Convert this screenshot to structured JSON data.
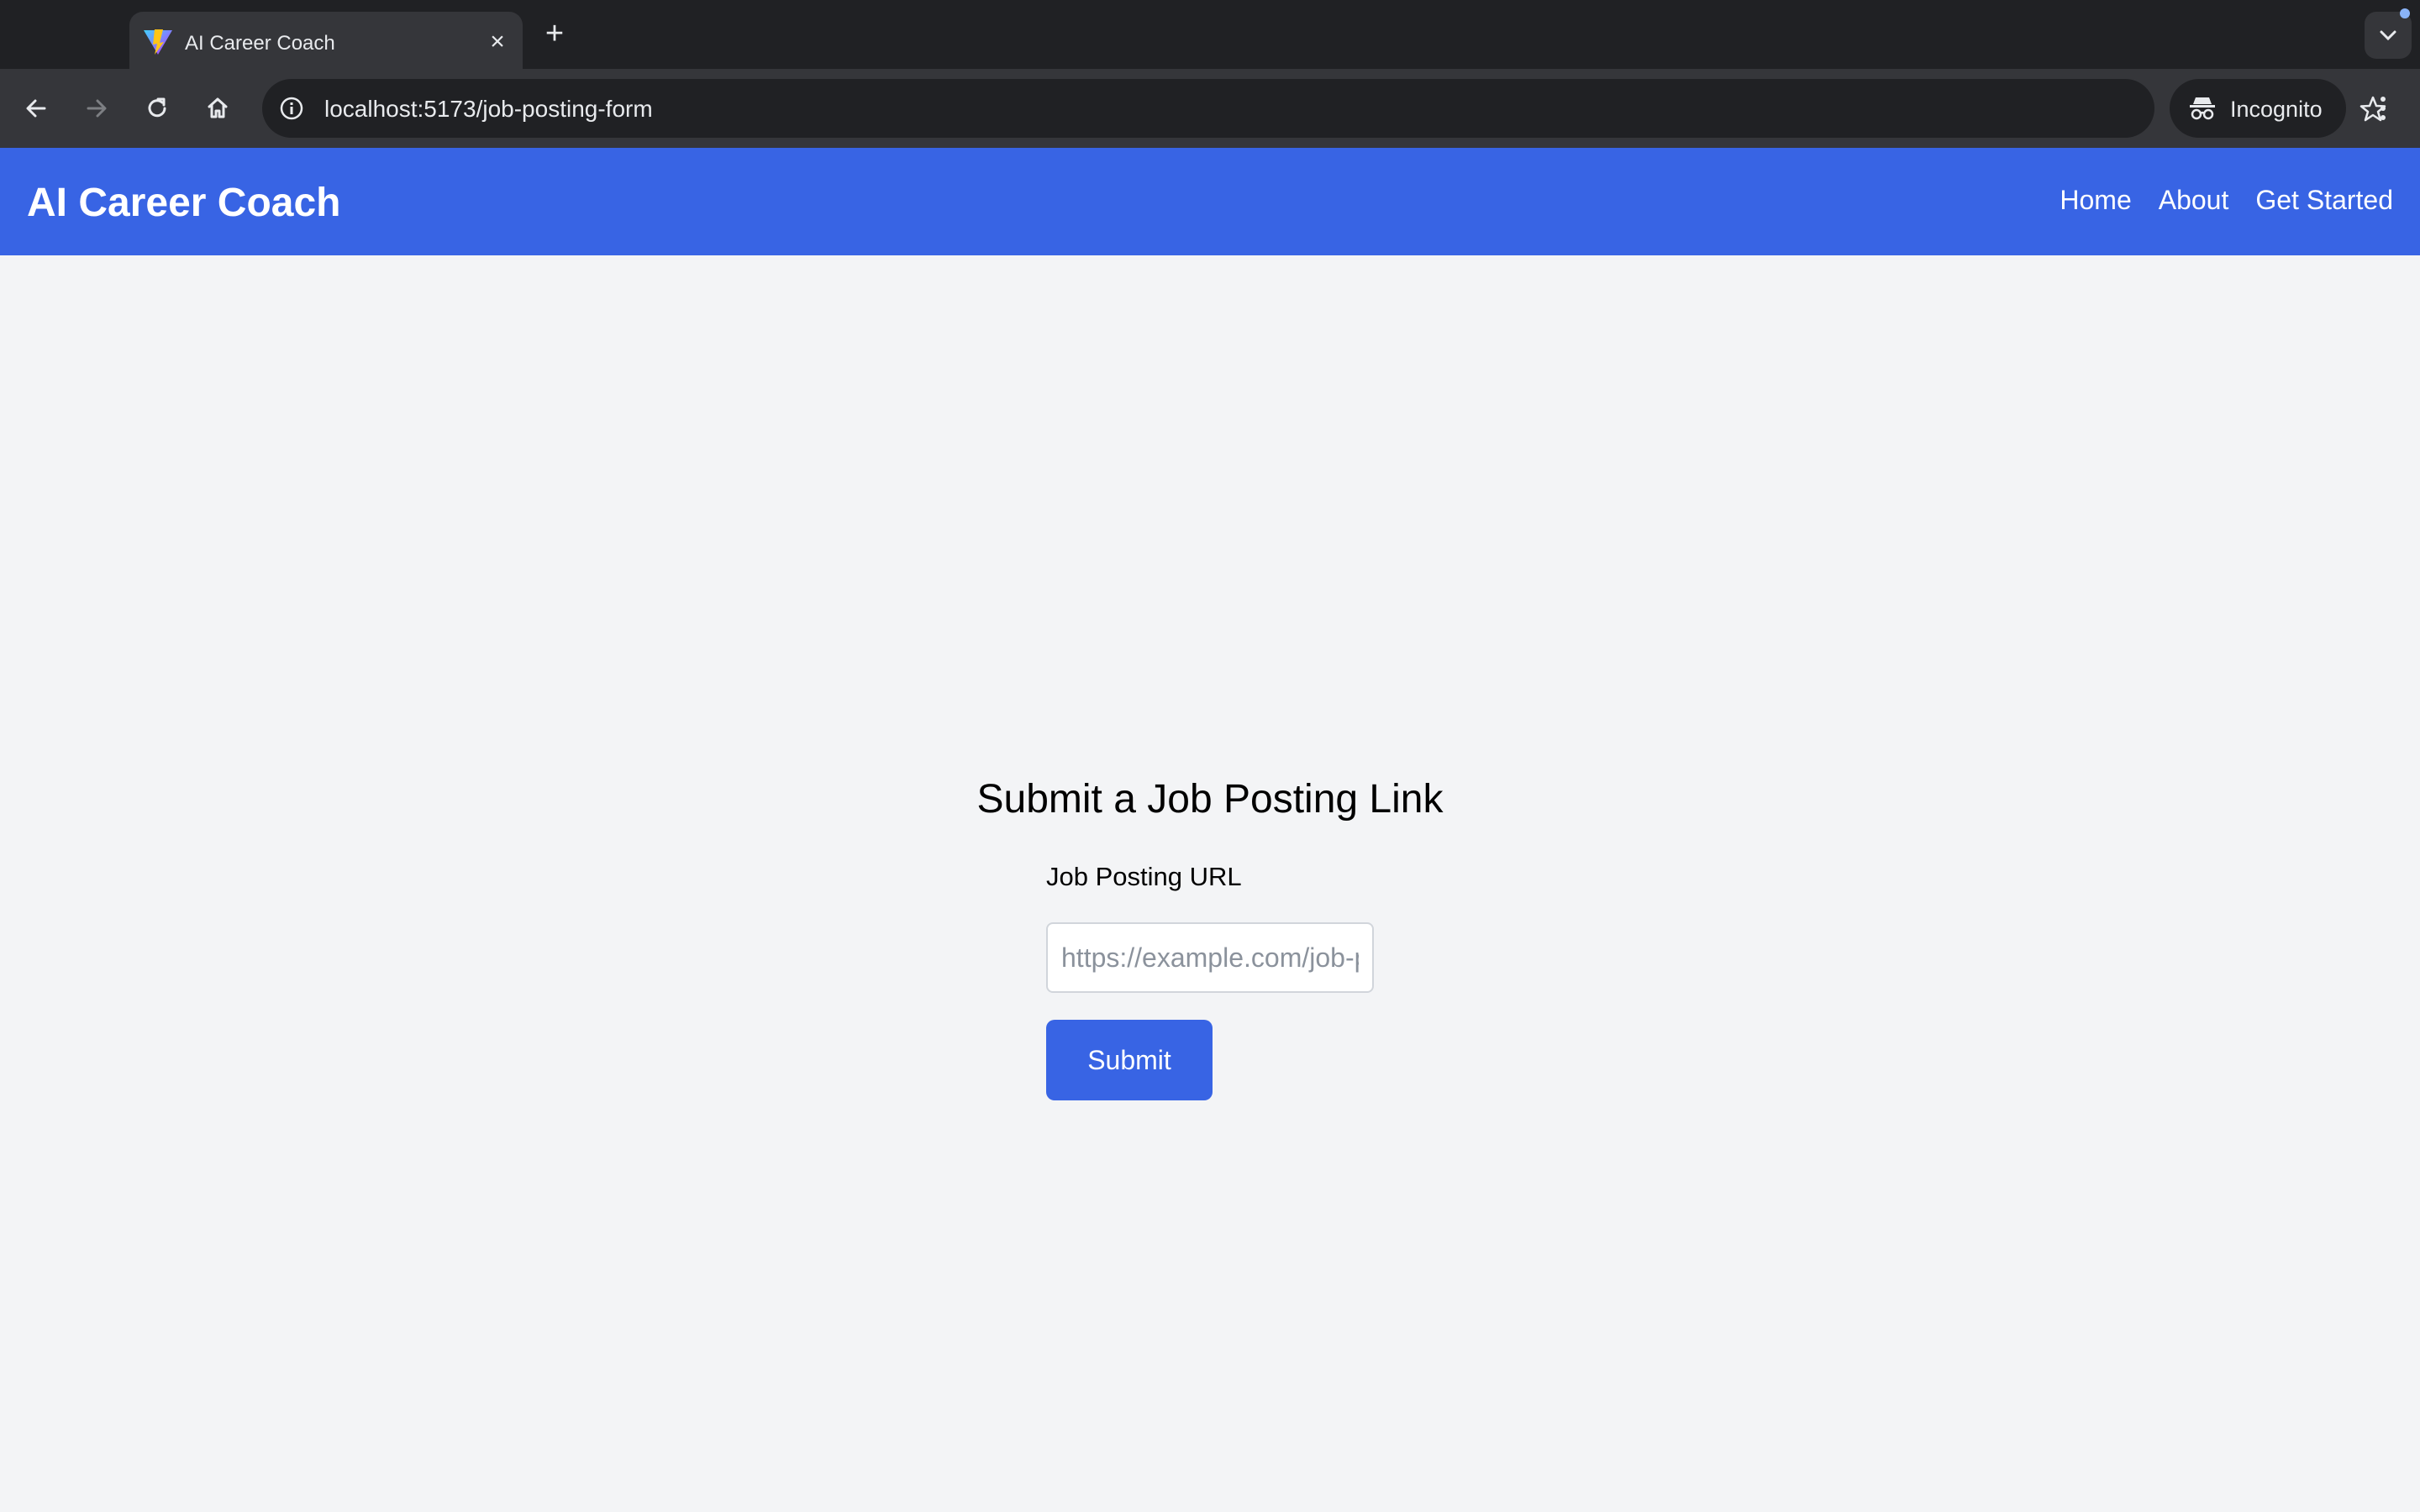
{
  "browser": {
    "tab": {
      "title": "AI Career Coach",
      "favicon": "vite-logo-icon",
      "close_icon": "close-icon"
    },
    "new_tab_icon": "plus-icon",
    "tab_search_icon": "chevron-down-icon",
    "toolbar": {
      "back_icon": "arrow-left-icon",
      "forward_icon": "arrow-right-icon",
      "reload_icon": "reload-icon",
      "home_icon": "home-icon",
      "site_info_icon": "info-icon",
      "url": "localhost:5173/job-posting-form",
      "bookmark_icon": "star-icon",
      "incognito_label": "Incognito",
      "menu_icon": "vertical-dots-icon"
    }
  },
  "app": {
    "brand": "AI Career Coach",
    "nav": [
      "Home",
      "About",
      "Get Started"
    ],
    "colors": {
      "primary": "#3864e4",
      "page_background": "#f3f4f6"
    }
  },
  "form": {
    "title": "Submit a Job Posting Link",
    "label": "Job Posting URL",
    "url_value": "",
    "placeholder": "https://example.com/job-posting",
    "submit_label": "Submit"
  }
}
